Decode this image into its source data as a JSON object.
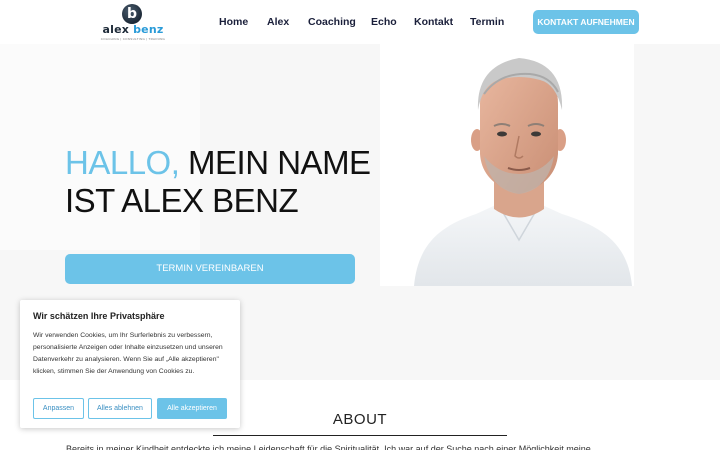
{
  "header": {
    "logo": {
      "mark_letter": "b",
      "word_a": "alex",
      "word_b": "benz",
      "tagline": "COACHING | CONSULTING | TRAINING"
    },
    "nav": [
      "Home",
      "Alex",
      "Coaching",
      "Echo",
      "Kontakt",
      "Termin"
    ],
    "cta_label": "KONTAKT AUFNEHMEN"
  },
  "hero": {
    "title_highlight": "HALLO,",
    "title_rest_line1": " MEIN NAME",
    "title_line2": "IST ALEX BENZ",
    "button_label": "TERMIN VEREINBAREN"
  },
  "about": {
    "title": "ABOUT",
    "text": "Bereits in meiner Kindheit entdeckte ich meine Leidenschaft für die Spiritualität. Ich war auf der Suche nach einer Möglichkeit meine"
  },
  "cookie": {
    "title": "Wir schätzen Ihre Privatsphäre",
    "text": "Wir verwenden Cookies, um Ihr Surferlebnis zu verbessern, personalisierte Anzeigen oder Inhalte einzusetzen und unseren Datenverkehr zu analysieren. Wenn Sie auf „Alle akzeptieren\" klicken, stimmen Sie der Anwendung von Cookies zu.",
    "btn_customize": "Anpassen",
    "btn_reject": "Alles ablehnen",
    "btn_accept": "Alle akzeptieren"
  },
  "colors": {
    "accent": "#6cc3e8",
    "nav_text": "#1a1f3a",
    "logo_dark": "#1d2a38",
    "logo_blue": "#2a9bd8"
  }
}
